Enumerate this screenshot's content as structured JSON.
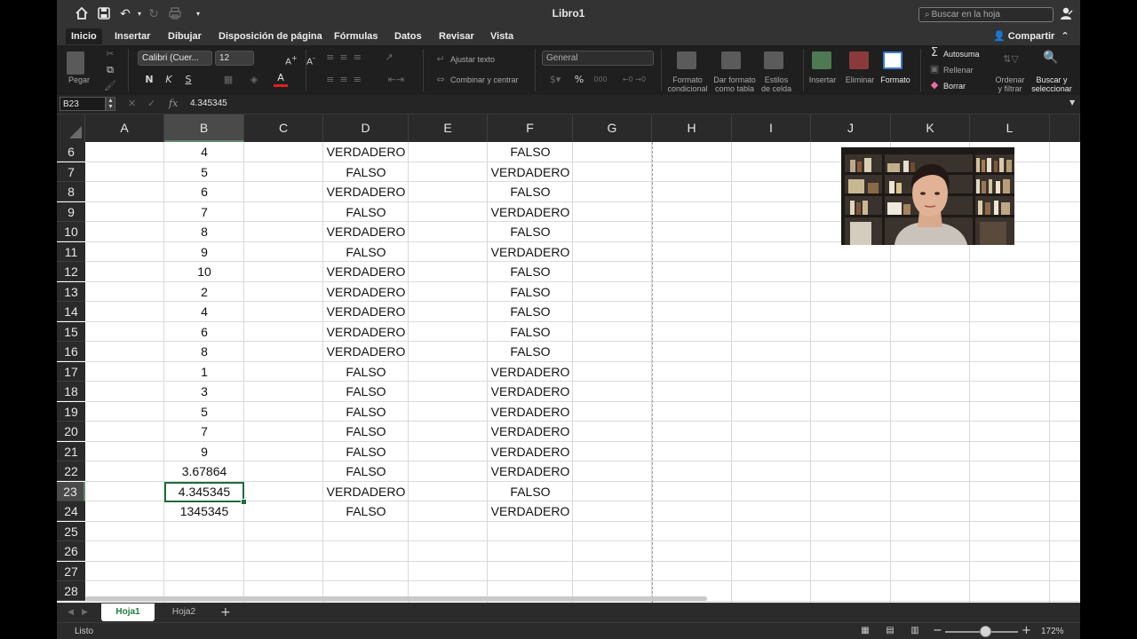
{
  "window": {
    "title": "Libro1",
    "search_placeholder": "Buscar en la hoja"
  },
  "tabs": [
    "Inicio",
    "Insertar",
    "Dibujar",
    "Disposición de página",
    "Fórmulas",
    "Datos",
    "Revisar",
    "Vista"
  ],
  "active_tab": "Inicio",
  "share_label": "Compartir",
  "ribbon": {
    "paste_label": "Pegar",
    "font_name": "Calibri (Cuer...",
    "font_size": "12",
    "bold": "N",
    "italic": "K",
    "underline": "S",
    "wrap_text": "Ajustar texto",
    "merge_center": "Combinar y centrar",
    "number_format": "General",
    "cond_format": [
      "Formato",
      "condicional"
    ],
    "format_table": [
      "Dar formato",
      "como tabla"
    ],
    "cell_styles": [
      "Estilos",
      "de celda"
    ],
    "insert": "Insertar",
    "delete": "Eliminar",
    "format": "Formato",
    "autosum": "Autosuma",
    "fill": "Rellenar",
    "clear": "Borrar",
    "sort_filter": [
      "Ordenar",
      "y filtrar"
    ],
    "find_select": [
      "Buscar y",
      "seleccionar"
    ]
  },
  "formula_bar": {
    "name_box": "B23",
    "fx": "fx",
    "formula": "4.345345"
  },
  "columns": [
    "A",
    "B",
    "C",
    "D",
    "E",
    "F",
    "G",
    "H",
    "I",
    "J",
    "K",
    "L"
  ],
  "selected_column": "B",
  "selected_row": "23",
  "rows": [
    {
      "row": "6",
      "b": "4",
      "d": "VERDADERO",
      "f": "FALSO"
    },
    {
      "row": "7",
      "b": "5",
      "d": "FALSO",
      "f": "VERDADERO"
    },
    {
      "row": "8",
      "b": "6",
      "d": "VERDADERO",
      "f": "FALSO"
    },
    {
      "row": "9",
      "b": "7",
      "d": "FALSO",
      "f": "VERDADERO"
    },
    {
      "row": "10",
      "b": "8",
      "d": "VERDADERO",
      "f": "FALSO"
    },
    {
      "row": "11",
      "b": "9",
      "d": "FALSO",
      "f": "VERDADERO"
    },
    {
      "row": "12",
      "b": "10",
      "d": "VERDADERO",
      "f": "FALSO"
    },
    {
      "row": "13",
      "b": "2",
      "d": "VERDADERO",
      "f": "FALSO"
    },
    {
      "row": "14",
      "b": "4",
      "d": "VERDADERO",
      "f": "FALSO"
    },
    {
      "row": "15",
      "b": "6",
      "d": "VERDADERO",
      "f": "FALSO"
    },
    {
      "row": "16",
      "b": "8",
      "d": "VERDADERO",
      "f": "FALSO"
    },
    {
      "row": "17",
      "b": "1",
      "d": "FALSO",
      "f": "VERDADERO"
    },
    {
      "row": "18",
      "b": "3",
      "d": "FALSO",
      "f": "VERDADERO"
    },
    {
      "row": "19",
      "b": "5",
      "d": "FALSO",
      "f": "VERDADERO"
    },
    {
      "row": "20",
      "b": "7",
      "d": "FALSO",
      "f": "VERDADERO"
    },
    {
      "row": "21",
      "b": "9",
      "d": "FALSO",
      "f": "VERDADERO"
    },
    {
      "row": "22",
      "b": "3.67864",
      "d": "FALSO",
      "f": "VERDADERO"
    },
    {
      "row": "23",
      "b": "4.345345",
      "d": "VERDADERO",
      "f": "FALSO"
    },
    {
      "row": "24",
      "b": "1345345",
      "d": "FALSO",
      "f": "VERDADERO"
    },
    {
      "row": "25",
      "b": "",
      "d": "",
      "f": ""
    },
    {
      "row": "26",
      "b": "",
      "d": "",
      "f": ""
    },
    {
      "row": "27",
      "b": "",
      "d": "",
      "f": ""
    },
    {
      "row": "28",
      "b": "",
      "d": "",
      "f": ""
    }
  ],
  "sheets": [
    "Hoja1",
    "Hoja2"
  ],
  "active_sheet": "Hoja1",
  "status": {
    "text": "Listo",
    "zoom_label": "172%",
    "zoom_fraction": 0.55
  },
  "colors": {
    "selection": "#1f6b3e",
    "active_sheet_text": "#1e7a3e",
    "grid_line": "#dadada",
    "chrome": "#2b2b2b"
  }
}
